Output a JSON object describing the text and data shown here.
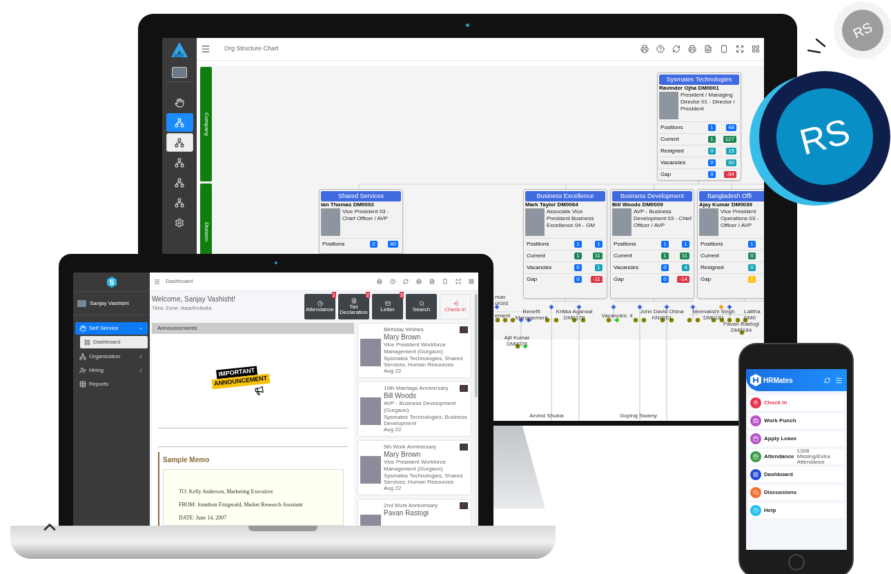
{
  "monitor": {
    "title": "Org Structure Chart",
    "nav": [
      {
        "kind": "avatar",
        "selected": false,
        "highlighted": false
      },
      {
        "kind": "hand",
        "selected": false,
        "highlighted": false
      },
      {
        "kind": "org",
        "selected": true,
        "highlighted": false
      },
      {
        "kind": "org",
        "selected": false,
        "highlighted": true
      },
      {
        "kind": "org",
        "selected": false,
        "highlighted": false
      },
      {
        "kind": "org",
        "selected": false,
        "highlighted": false
      },
      {
        "kind": "org",
        "selected": false,
        "highlighted": false
      },
      {
        "kind": "gear",
        "selected": false,
        "highlighted": false
      }
    ],
    "levels": [
      "Company",
      "Division"
    ],
    "cards": [
      {
        "title": "Sysmates Technologies",
        "person": "Ravinder Ojha DM0001",
        "role": "President / Managing Director 01 - Director / President",
        "stats": [
          {
            "label": "Positions",
            "values": [
              {
                "text": "1",
                "color": "#0d6efd"
              },
              {
                "text": "48",
                "color": "#0d6efd"
              }
            ]
          },
          {
            "label": "Current",
            "values": [
              {
                "text": "1",
                "color": "#198754"
              },
              {
                "text": "127",
                "color": "#198754"
              }
            ]
          },
          {
            "label": "Resigned",
            "values": [
              {
                "text": "0",
                "color": "#17a2b8"
              },
              {
                "text": "15",
                "color": "#17a2b8"
              }
            ]
          },
          {
            "label": "Vacancies",
            "values": [
              {
                "text": "0",
                "color": "#0d6efd"
              },
              {
                "text": "30",
                "color": "#17a2b8"
              }
            ]
          },
          {
            "label": "Gap",
            "values": [
              {
                "text": "0",
                "color": "#0d6efd"
              },
              {
                "text": "-94",
                "color": "#dc3545"
              }
            ]
          }
        ]
      },
      {
        "title": "Shared Services",
        "person": "Ian Thomas DM0002",
        "role": "Vice President 03 - Chief Officer / AVP",
        "stats": [
          {
            "label": "Positions",
            "values": [
              {
                "text": "2",
                "color": "#0d6efd"
              },
              {
                "text": "40",
                "color": "#0d6efd"
              }
            ]
          }
        ]
      },
      {
        "title": "Business Excellence",
        "person": "Mark Taylor DM0064",
        "role": "Associate Vice President Business Excellence 04 - GM",
        "stats": [
          {
            "label": "Positions",
            "values": [
              {
                "text": "1",
                "color": "#0d6efd"
              },
              {
                "text": "1",
                "color": "#0d6efd"
              }
            ]
          },
          {
            "label": "Current",
            "values": [
              {
                "text": "1",
                "color": "#198754"
              },
              {
                "text": "11",
                "color": "#198754"
              }
            ]
          },
          {
            "label": "Vacancies",
            "values": [
              {
                "text": "0",
                "color": "#0d6efd"
              },
              {
                "text": "1",
                "color": "#17a2b8"
              }
            ]
          },
          {
            "label": "Gap",
            "values": [
              {
                "text": "0",
                "color": "#0d6efd"
              },
              {
                "text": "-11",
                "color": "#dc3545"
              }
            ]
          }
        ]
      },
      {
        "title": "Business Development",
        "person": "Bill Woods DM0009",
        "role": "AVP - Business Development 03 - Chief Officer / AVP",
        "stats": [
          {
            "label": "Positions",
            "values": [
              {
                "text": "1",
                "color": "#0d6efd"
              },
              {
                "text": "1",
                "color": "#0d6efd"
              }
            ]
          },
          {
            "label": "Current",
            "values": [
              {
                "text": "1",
                "color": "#198754"
              },
              {
                "text": "11",
                "color": "#198754"
              }
            ]
          },
          {
            "label": "Vacancies",
            "values": [
              {
                "text": "0",
                "color": "#0d6efd"
              },
              {
                "text": "4",
                "color": "#17a2b8"
              }
            ]
          },
          {
            "label": "Gap",
            "values": [
              {
                "text": "0",
                "color": "#0d6efd"
              },
              {
                "text": "-14",
                "color": "#dc3545"
              }
            ]
          }
        ]
      },
      {
        "title": "Bangladesh Offi",
        "person": "Ajay Kumar DM0039",
        "role": "Vice President\nOperations 03 -\nOfficer / AVP",
        "stats": [
          {
            "label": "Positions",
            "values": [
              {
                "text": "1",
                "color": "#0d6efd"
              }
            ]
          },
          {
            "label": "Current",
            "values": [
              {
                "text": "0",
                "color": "#198754"
              }
            ]
          },
          {
            "label": "Resigned",
            "values": [
              {
                "text": "0",
                "color": "#17a2b8"
              }
            ]
          },
          {
            "label": "Gap",
            "values": [
              {
                "text": "1",
                "color": "#ffc107"
              }
            ]
          }
        ]
      }
    ],
    "tree_labels": [
      "man\nurces",
      "ement",
      "Benefit\nManagement",
      "Kritika Agarwal\nDM0179",
      "Vacancies: 4",
      "John David Ohina\nKN0001",
      "Meenakshi Singh\nDM0181",
      "Lalitha\nDM0",
      "Pavan Rastogi\nDM0184",
      "Ajit Kumar\nDM0075",
      "Arvind Shukla",
      "Gopiraj Swamy"
    ]
  },
  "laptop": {
    "user": "Sanjay Vashisht",
    "menu": [
      {
        "label": "Self Service",
        "kind": "hand",
        "selected": true,
        "expanded": true,
        "children": [
          {
            "label": "Dashboard",
            "kind": "grid",
            "selected": true
          }
        ]
      },
      {
        "label": "Organization",
        "kind": "org",
        "selected": false,
        "expanded": false
      },
      {
        "label": "Hiring",
        "kind": "user",
        "selected": false,
        "expanded": false
      },
      {
        "label": "Reports",
        "kind": "table",
        "selected": false
      }
    ],
    "breadcrumb": "Dashboard",
    "welcome": "Welcome, Sanjay Vashisht!",
    "timezone": "Time Zone: Asia/Kolkata",
    "quick": [
      {
        "label": "Attendance",
        "kind": "clock",
        "badge": "1"
      },
      {
        "label": "Tax Declaration",
        "kind": "file",
        "badge": "2"
      },
      {
        "label": "Letter",
        "kind": "mail",
        "badge": "3"
      },
      {
        "label": "Search",
        "kind": "search"
      },
      {
        "label": "Check in",
        "kind": "checkin"
      }
    ],
    "announcements": {
      "title": "Announcements",
      "image_text": [
        "IMPORTANT",
        "ANNOUNCEMENT"
      ],
      "memo_title": "Sample Memo",
      "memo_lines": [
        "TO: Kelly Anderson, Marketing Executive",
        "FROM: Jonathon Fitzgerald, Market Research Assistant",
        "DATE: June 14, 2007"
      ]
    },
    "events": [
      {
        "event": "Birthday Wishes",
        "name": "Mary Brown",
        "role": "Vice President Workforce Management (Gurgaon)",
        "org": "Sysmates Technologies, Shared Services, Human Resources",
        "date": "Aug 22"
      },
      {
        "event": "10th Marriage Anniversary",
        "name": "Bill Woods",
        "role": "AVP - Business Development (Gurgaon)",
        "org": "Sysmates Technologies, Business Development",
        "date": "Aug 22"
      },
      {
        "event": "5th Work Anniversary",
        "name": "Mary Brown",
        "role": "Vice President Workforce Management (Gurgaon)",
        "org": "Sysmates Technologies, Shared Services, Human Resources",
        "date": "Aug 22"
      },
      {
        "event": "2nd Work Anniversary",
        "name": "Pavan Rastogi"
      }
    ]
  },
  "phone": {
    "app": "HRMates",
    "items": [
      {
        "label": "Check In",
        "kind": "pin",
        "color": "#e8344e",
        "alert": true
      },
      {
        "label": "Work Punch",
        "kind": "briefcase",
        "color": "#b455c9",
        "alert": false
      },
      {
        "label": "Apply Leave",
        "kind": "calendar",
        "color": "#b455c9",
        "alert": false
      },
      {
        "label": "Attendance",
        "kind": "calendar-check",
        "color": "#3a9a46",
        "alert": false,
        "note": "1398 Missing/Extra Attendance"
      },
      {
        "label": "Dashboard",
        "kind": "grid",
        "color": "#2448d8",
        "alert": false
      },
      {
        "label": "Discussions",
        "kind": "chat",
        "color": "#f07030",
        "alert": false
      },
      {
        "label": "Help",
        "kind": "help",
        "color": "#1ec0f0",
        "alert": false
      }
    ]
  },
  "badges": [
    "RS",
    "RS"
  ]
}
